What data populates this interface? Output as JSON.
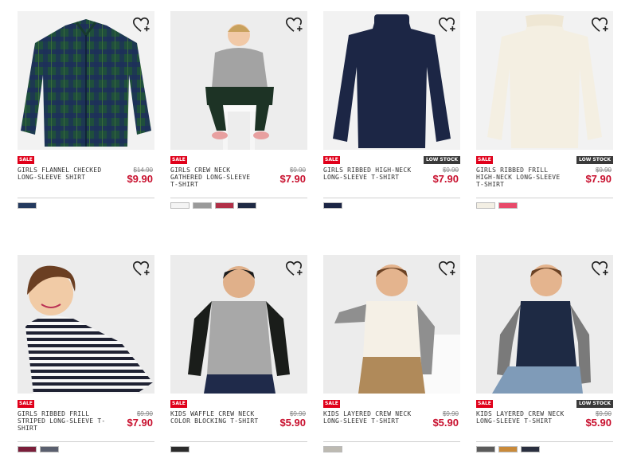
{
  "products": [
    {
      "sale": "SALE",
      "low_stock": "",
      "name": "GIRLS FLANNEL CHECKED LONG-SLEEVE SHIRT",
      "old_price": "$14.90",
      "price": "$9.90",
      "swatches": [
        "#243a5e"
      ],
      "image": "plaid-shirt",
      "bg": "#f2f2f2"
    },
    {
      "sale": "SALE",
      "low_stock": "",
      "name": "GIRLS CREW NECK GATHERED LONG-SLEEVE T-SHIRT",
      "old_price": "$9.90",
      "price": "$7.90",
      "swatches": [
        "#f4f4f4",
        "#9a9a9a",
        "#b13048",
        "#1f2a44"
      ],
      "image": "girl-sitting",
      "bg": "#ededed"
    },
    {
      "sale": "SALE",
      "low_stock": "LOW STOCK",
      "name": "GIRLS RIBBED HIGH-NECK LONG-SLEEVE T-SHIRT",
      "old_price": "$9.90",
      "price": "$7.90",
      "swatches": [
        "#1c2645"
      ],
      "image": "navy-top",
      "bg": "#f2f2f2"
    },
    {
      "sale": "SALE",
      "low_stock": "LOW STOCK",
      "name": "GIRLS RIBBED FRILL HIGH-NECK LONG-SLEEVE T-SHIRT",
      "old_price": "$9.90",
      "price": "$7.90",
      "swatches": [
        "#f3efe4",
        "#e84a6a"
      ],
      "image": "cream-top",
      "bg": "#f2f2f2"
    },
    {
      "sale": "SALE",
      "low_stock": "",
      "name": "GIRLS RIBBED FRILL STRIPED LONG-SLEEVE T-SHIRT",
      "old_price": "$9.90",
      "price": "$7.90",
      "swatches": [
        "#7a1e3a",
        "#5a5f6e"
      ],
      "image": "striped-girl",
      "bg": "#ececec"
    },
    {
      "sale": "SALE",
      "low_stock": "",
      "name": "KIDS WAFFLE CREW NECK COLOR BLOCKING T-SHIRT",
      "old_price": "$9.90",
      "price": "$5.90",
      "swatches": [
        "#2b2b2b"
      ],
      "image": "raglan-boy",
      "bg": "#ececec"
    },
    {
      "sale": "SALE",
      "low_stock": "",
      "name": "KIDS LAYERED CREW NECK LONG-SLEEVE T-SHIRT",
      "old_price": "$9.90",
      "price": "$5.90",
      "swatches": [
        "#bdbab2"
      ],
      "image": "layered-boy-white",
      "bg": "#ececec"
    },
    {
      "sale": "SALE",
      "low_stock": "LOW STOCK",
      "name": "KIDS LAYERED CREW NECK LONG-SLEEVE T-SHIRT",
      "old_price": "$9.90",
      "price": "$5.90",
      "swatches": [
        "#5b5b5b",
        "#c98a3a",
        "#2a2f3f"
      ],
      "image": "layered-boy-navy",
      "bg": "#ececec"
    }
  ]
}
